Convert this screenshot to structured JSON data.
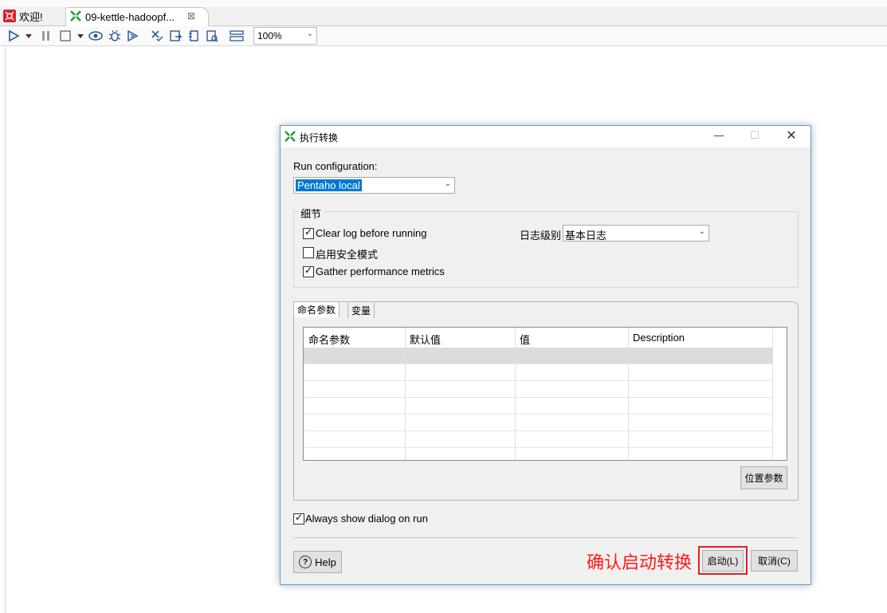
{
  "tabs": [
    {
      "label": "欢迎!",
      "icon": "spoon-logo-icon"
    },
    {
      "label": "09-kettle-hadoopf...",
      "icon": "transformation-icon",
      "close": "⊠"
    }
  ],
  "toolbar": {
    "zoom": "100%",
    "icons": [
      "run-icon",
      "run-dropdown-icon",
      "pause-icon",
      "stop-icon",
      "stop-dropdown-icon",
      "preview-icon",
      "debug-icon",
      "replay-icon",
      "verify-icon",
      "impact-icon",
      "sql-icon",
      "explore-db-icon",
      "show-results-icon"
    ]
  },
  "dialog": {
    "title": "执行转换",
    "run_config_label": "Run configuration:",
    "run_config_value": "Pentaho local",
    "details_group": "细节",
    "clear_log": {
      "label": "Clear log before running",
      "checked": true
    },
    "safe_mode": {
      "label": "启用安全模式",
      "checked": false
    },
    "gather_metrics": {
      "label": "Gather performance metrics",
      "checked": true
    },
    "log_level_label": "日志级别",
    "log_level_value": "基本日志",
    "param_tabs": [
      "命名参数",
      "变量"
    ],
    "table_headers": [
      "命名参数",
      "默认值",
      "值",
      "Description"
    ],
    "position_params_button": "位置参数",
    "always_show": {
      "label": "Always show dialog on run",
      "checked": true
    },
    "help_button": "Help",
    "start_button": "启动(L)",
    "cancel_button": "取消(C)"
  },
  "annotation": "确认启动转换",
  "colors": {
    "annotation": "#ff1a1a",
    "accent": "#0078d7",
    "kettle_green": "#1e9e3a"
  }
}
